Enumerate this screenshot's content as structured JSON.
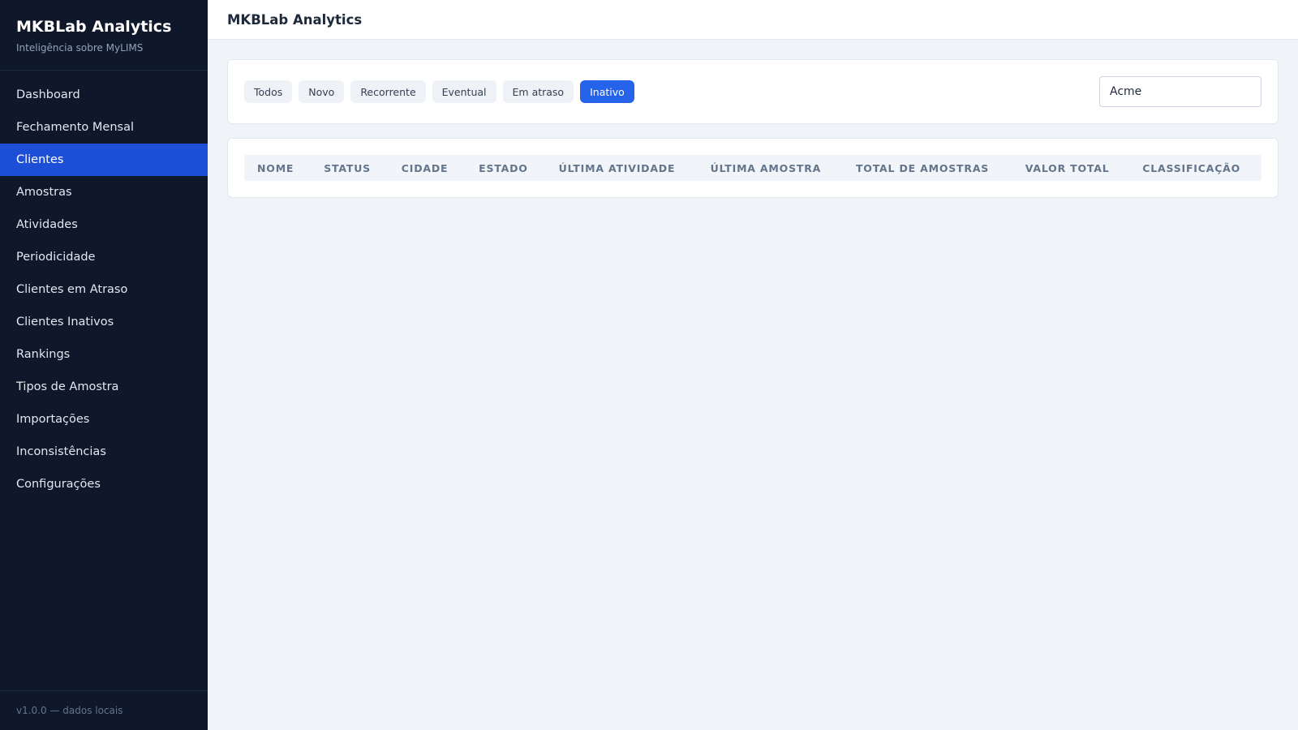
{
  "sidebar": {
    "brand_title": "MKBLab Analytics",
    "brand_subtitle": "Inteligência sobre MyLIMS",
    "items": [
      {
        "label": "Dashboard"
      },
      {
        "label": "Fechamento Mensal"
      },
      {
        "label": "Clientes",
        "active": true
      },
      {
        "label": "Amostras"
      },
      {
        "label": "Atividades"
      },
      {
        "label": "Periodicidade"
      },
      {
        "label": "Clientes em Atraso"
      },
      {
        "label": "Clientes Inativos"
      },
      {
        "label": "Rankings"
      },
      {
        "label": "Tipos de Amostra"
      },
      {
        "label": "Importações"
      },
      {
        "label": "Inconsistências"
      },
      {
        "label": "Configurações"
      }
    ],
    "footer": "v1.0.0 — dados locais"
  },
  "header": {
    "title": "MKBLab Analytics"
  },
  "filters": {
    "chips": [
      {
        "label": "Todos"
      },
      {
        "label": "Novo"
      },
      {
        "label": "Recorrente"
      },
      {
        "label": "Eventual"
      },
      {
        "label": "Em atraso"
      },
      {
        "label": "Inativo",
        "active": true
      }
    ],
    "search_value": "Acme"
  },
  "table": {
    "columns": [
      "NOME",
      "STATUS",
      "CIDADE",
      "ESTADO",
      "ÚLTIMA ATIVIDADE",
      "ÚLTIMA AMOSTRA",
      "TOTAL DE AMOSTRAS",
      "VALOR TOTAL",
      "CLASSIFICAÇÃO"
    ],
    "rows": []
  },
  "colors": {
    "sidebar_bg": "#0f172a",
    "accent": "#2563eb",
    "active_nav": "#1d4ed8",
    "page_bg": "#f0f4f8"
  }
}
